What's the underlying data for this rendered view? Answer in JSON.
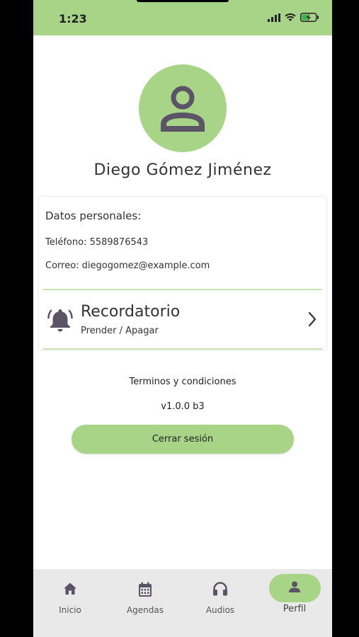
{
  "status_bar": {
    "time": "1:23"
  },
  "profile": {
    "name": "Diego Gómez Jiménez"
  },
  "personal_data": {
    "title": "Datos personales:",
    "phone": "Teléfono: 5589876543",
    "email": "Correo: diegogomez@example.com"
  },
  "reminder": {
    "title": "Recordatorio",
    "subtitle": "Prender / Apagar"
  },
  "footer": {
    "terms": "Terminos y condiciones",
    "version": "v1.0.0 b3",
    "logout_label": "Cerrar sesión"
  },
  "nav": {
    "items": [
      {
        "label": "Inicio",
        "icon": "home-icon"
      },
      {
        "label": "Agendas",
        "icon": "calendar-icon"
      },
      {
        "label": "Audios",
        "icon": "headphones-icon"
      },
      {
        "label": "Perfil",
        "icon": "person-icon",
        "active": true
      }
    ]
  },
  "colors": {
    "accent": "#a8d488",
    "icon": "#5a5466",
    "nav_bg": "#e9e9ea"
  }
}
